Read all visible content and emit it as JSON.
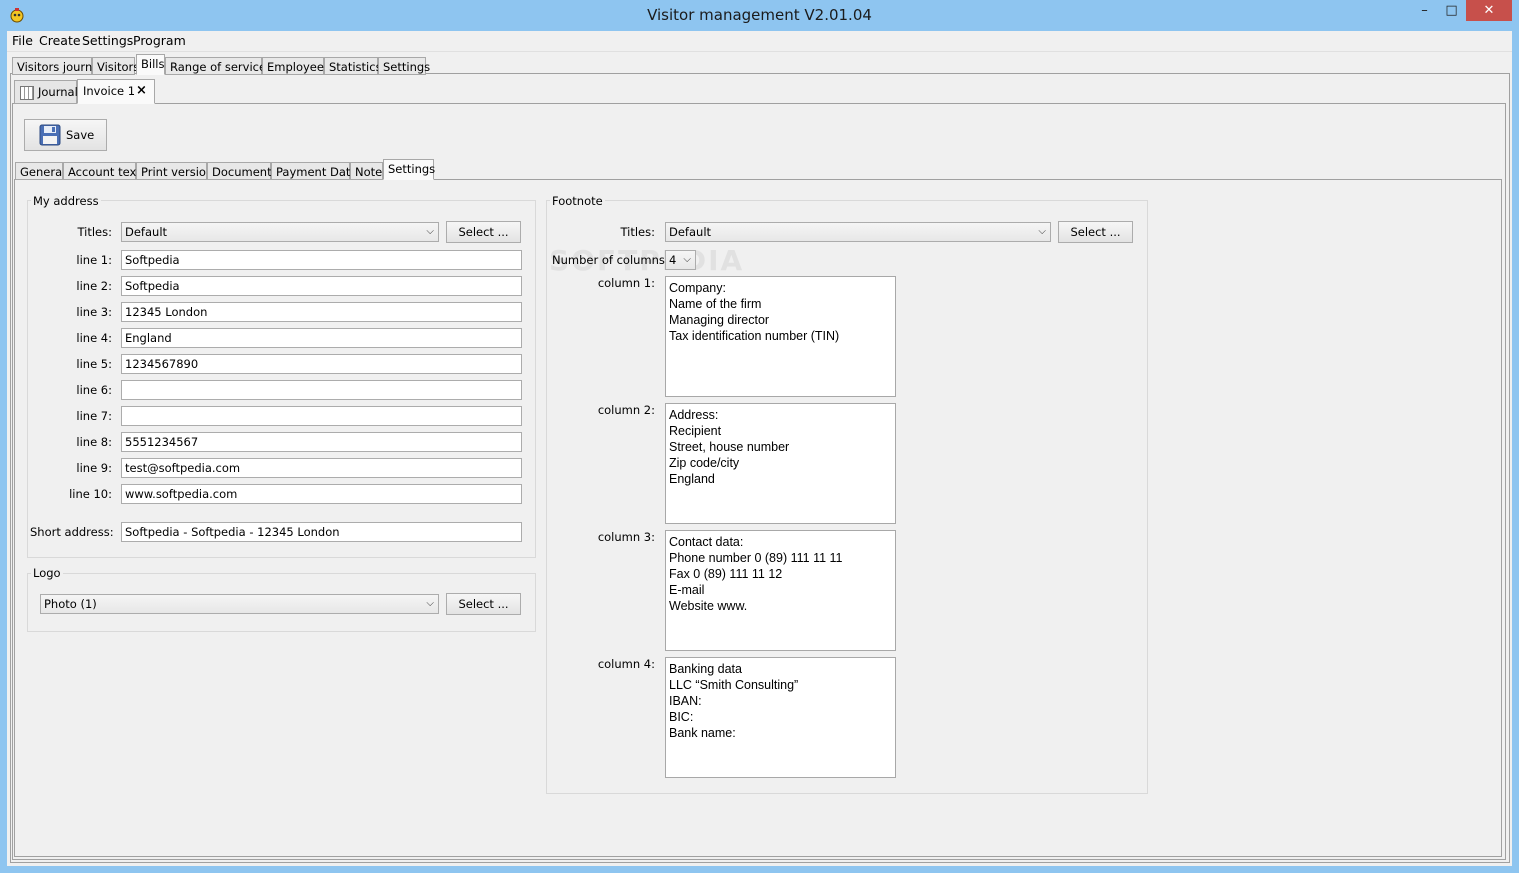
{
  "window": {
    "title": "Visitor management V2.01.04",
    "controls": {
      "minimize": "–",
      "maximize": "□",
      "close": "✕"
    }
  },
  "menu": [
    "File",
    "Create",
    "Settings",
    "Program"
  ],
  "main_tabs": [
    "Visitors journal",
    "Visitors",
    "Bills",
    "Range of services",
    "Employees",
    "Statistics",
    "Settings"
  ],
  "doc_tabs": {
    "journal": "Journal",
    "invoice": "Invoice 1",
    "close": "×"
  },
  "toolbar": {
    "save_label": "Save"
  },
  "sub_tabs": [
    "General",
    "Account text",
    "Print version",
    "Documents",
    "Payment Data",
    "Note",
    "Settings"
  ],
  "my_address": {
    "title": "My address",
    "titles_label": "Titles:",
    "titles_value": "Default",
    "select_label": "Select ...",
    "lines": [
      {
        "label": "line 1:",
        "value": "Softpedia"
      },
      {
        "label": "line 2:",
        "value": "Softpedia"
      },
      {
        "label": "line 3:",
        "value": "12345 London"
      },
      {
        "label": "line 4:",
        "value": "England"
      },
      {
        "label": "line 5:",
        "value": "1234567890"
      },
      {
        "label": "line 6:",
        "value": ""
      },
      {
        "label": "line 7:",
        "value": ""
      },
      {
        "label": "line 8:",
        "value": "5551234567"
      },
      {
        "label": "line 9:",
        "value": "test@softpedia.com"
      },
      {
        "label": "line 10:",
        "value": "www.softpedia.com"
      }
    ],
    "short_label": "Short address:",
    "short_value": "Softpedia - Softpedia - 12345 London"
  },
  "logo": {
    "title": "Logo",
    "value": "Photo (1)",
    "select_label": "Select ..."
  },
  "footnote": {
    "title": "Footnote",
    "titles_label": "Titles:",
    "titles_value": "Default",
    "select_label": "Select ...",
    "columns_label": "Number of columns:",
    "columns_value": "4",
    "columns": [
      {
        "label": "column 1:",
        "lines": [
          "Company:",
          "Name of the firm",
          "Managing director",
          "Tax identification number (TIN)"
        ]
      },
      {
        "label": "column 2:",
        "lines": [
          "Address:",
          "Recipient",
          "Street, house number",
          "Zip code/city",
          "England"
        ]
      },
      {
        "label": "column 3:",
        "lines": [
          "Contact data:",
          "Phone number 0 (89) 111 11 11",
          "Fax 0 (89) 111 11 12",
          "E-mail",
          "Website www."
        ]
      },
      {
        "label": "column 4:",
        "lines": [
          "Banking data",
          "LLC “Smith Consulting”",
          "IBAN:",
          "BIC:",
          "Bank name:"
        ]
      }
    ]
  },
  "watermark": "SOFTPEDIA"
}
